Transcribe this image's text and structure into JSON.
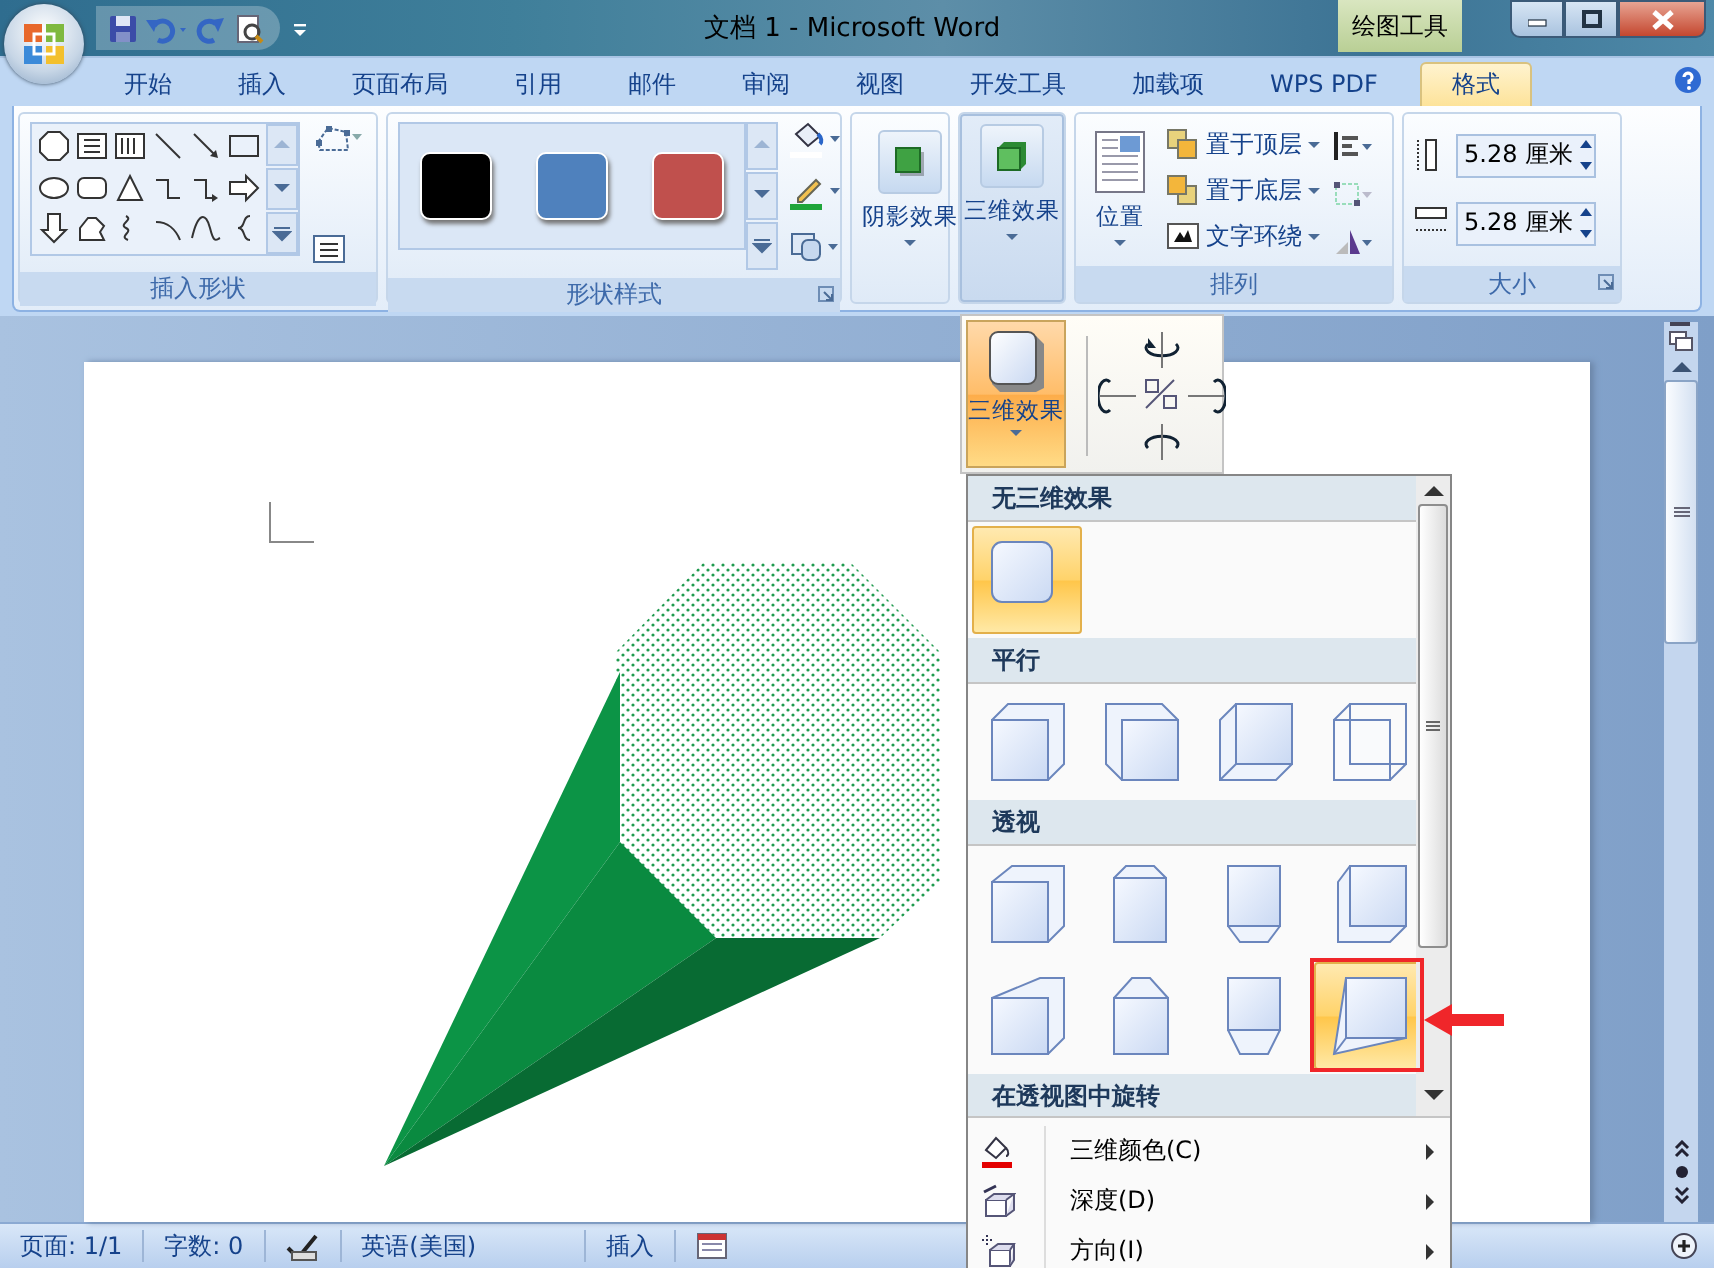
{
  "title_bar": {
    "title": "文档 1 - Microsoft Word",
    "context_tab": "绘图工具"
  },
  "tabs": [
    {
      "label": "开始",
      "selected": false
    },
    {
      "label": "插入",
      "selected": false
    },
    {
      "label": "页面布局",
      "selected": false
    },
    {
      "label": "引用",
      "selected": false
    },
    {
      "label": "邮件",
      "selected": false
    },
    {
      "label": "审阅",
      "selected": false
    },
    {
      "label": "视图",
      "selected": false
    },
    {
      "label": "开发工具",
      "selected": false
    },
    {
      "label": "加载项",
      "selected": false
    },
    {
      "label": "WPS PDF",
      "selected": false
    },
    {
      "label": "格式",
      "selected": true
    }
  ],
  "ribbon": {
    "insert_shapes": {
      "label": "插入形状"
    },
    "shape_styles": {
      "label": "形状样式",
      "swatches": [
        {
          "color": "#000000"
        },
        {
          "color": "#4f81bd"
        },
        {
          "color": "#c0504d"
        }
      ]
    },
    "shadow_effects": {
      "label": "阴影效果",
      "selected": false
    },
    "three_d_effects": {
      "label": "三维效果",
      "selected": true
    },
    "arrange": {
      "label": "排列",
      "position": "位置",
      "items": [
        "置于顶层",
        "置于底层",
        "文字环绕"
      ]
    },
    "size": {
      "label": "大小",
      "height": "5.28 厘米",
      "width": "5.28 厘米"
    }
  },
  "effects_menu": {
    "button": {
      "label": "三维效果",
      "selected": true
    },
    "sections": [
      {
        "heading": "无三维效果",
        "items": [
          {
            "selected": true
          }
        ]
      },
      {
        "heading": "平行",
        "items": [
          {
            "selected": false
          },
          {
            "selected": false
          },
          {
            "selected": false
          },
          {
            "selected": false
          }
        ]
      },
      {
        "heading": "透视",
        "items": [
          {
            "selected": false
          },
          {
            "selected": false
          },
          {
            "selected": false
          },
          {
            "selected": false
          },
          {
            "selected": false
          },
          {
            "selected": false
          },
          {
            "selected": false
          },
          {
            "selected": true
          }
        ]
      },
      {
        "heading": "在透视图中旋转"
      }
    ],
    "commands": [
      {
        "label": "三维颜色(C)",
        "submenu": true
      },
      {
        "label": "深度(D)",
        "submenu": true
      },
      {
        "label": "方向(I)",
        "submenu": true
      }
    ]
  },
  "status_bar": {
    "page": "页面: 1/1",
    "words": "字数: 0",
    "language": "英语(美国)",
    "mode": "插入"
  }
}
